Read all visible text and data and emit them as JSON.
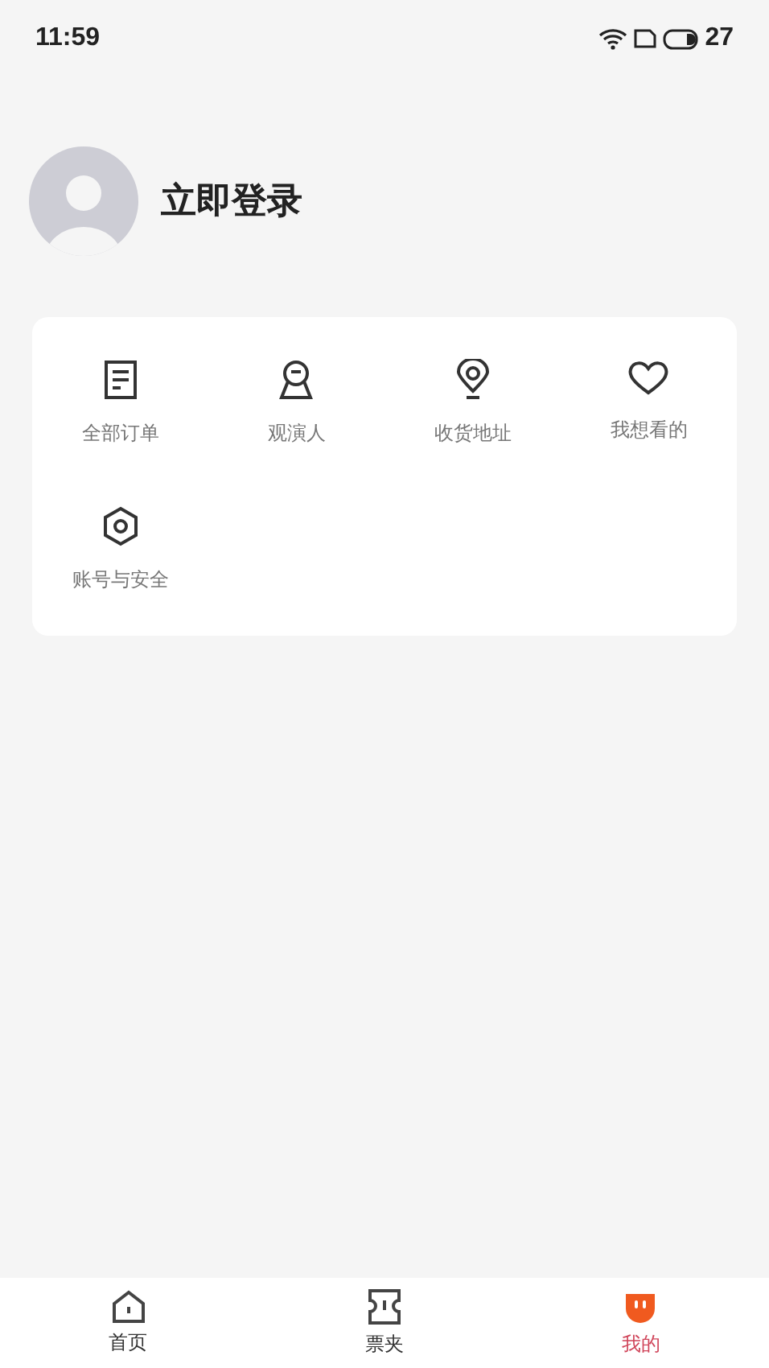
{
  "status_bar": {
    "time": "11:59",
    "battery": "27"
  },
  "profile": {
    "login_label": "立即登录"
  },
  "menu": [
    {
      "kind": "document",
      "label": "全部订单"
    },
    {
      "kind": "person",
      "label": "观演人"
    },
    {
      "kind": "location",
      "label": "收货地址"
    },
    {
      "kind": "heart",
      "label": "我想看的"
    },
    {
      "kind": "hexagon",
      "label": "账号与安全"
    }
  ],
  "tab_bar": [
    {
      "kind": "home",
      "label": "首页",
      "selected": false
    },
    {
      "kind": "ticket",
      "label": "票夹",
      "selected": false
    },
    {
      "kind": "mine",
      "label": "我的",
      "selected": true
    }
  ]
}
